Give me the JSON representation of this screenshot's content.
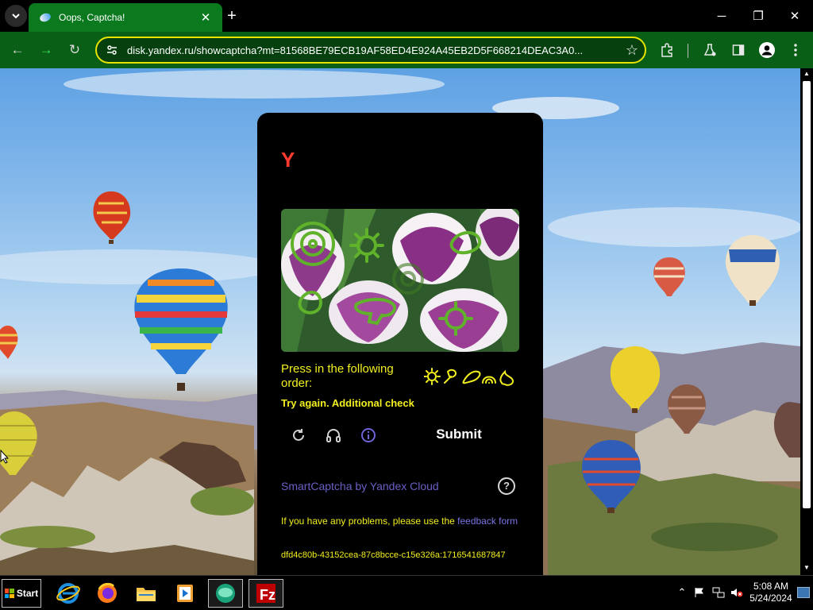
{
  "tab": {
    "title": "Oops, Captcha!",
    "close": "✕"
  },
  "newtab": "+",
  "window": {
    "minimize": "─",
    "restore": "❐",
    "close": "✕"
  },
  "toolbar": {
    "back": "←",
    "forward": "→",
    "reload": "↻",
    "url": "disk.yandex.ru/showcaptcha?mt=81568BE79ECB19AF58ED4E924A45EB2D5F668214DEAC3A0...",
    "star": "☆"
  },
  "captcha": {
    "logo": "Y",
    "instruction": "Press in the following order:",
    "error": "Try again. Additional check",
    "submit": "Submit",
    "brand": "SmartCaptcha by Yandex Cloud",
    "help": "?",
    "problem_prefix": "If you have any problems, please use the ",
    "problem_link": "feedback form",
    "hash": "dfd4c80b-43152cea-87c8bcce-c15e326a:1716541687847"
  },
  "taskbar": {
    "start": "Start",
    "time": "5:08 AM",
    "date": "5/24/2024",
    "tray_chevron": "⌃"
  },
  "colors": {
    "tab_green": "#0b7a1e",
    "toolbar_green": "#0a5f17",
    "url_border": "#e7e400",
    "captcha_yellow": "#f2ef1f",
    "brand_purple": "#6760c5",
    "yandex_red": "#ff3b2f"
  },
  "icons": [
    "tab-search-icon",
    "favicon-icon",
    "site-settings-icon",
    "star-icon",
    "extensions-icon",
    "labs-icon",
    "sidepanel-icon",
    "profile-icon",
    "menu-icon",
    "reload-icon",
    "audio-icon",
    "info-icon",
    "help-icon"
  ]
}
